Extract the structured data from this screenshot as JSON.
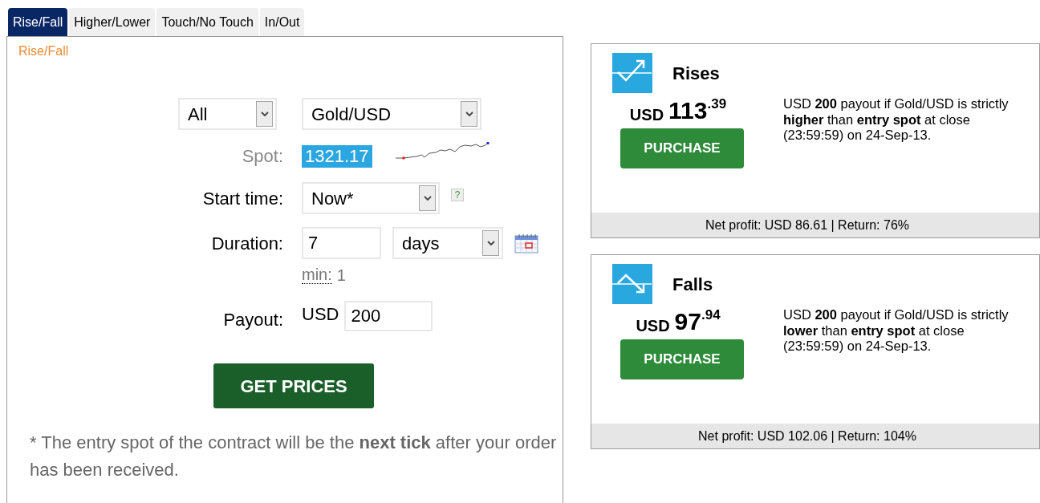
{
  "tabs": [
    {
      "label": "Rise/Fall",
      "selected": true
    },
    {
      "label": "Higher/Lower",
      "selected": false
    },
    {
      "label": "Touch/No Touch",
      "selected": false
    },
    {
      "label": "In/Out",
      "selected": false
    }
  ],
  "panel_title": "Rise/Fall",
  "form": {
    "market_filter": "All",
    "market": "Gold/USD",
    "spot": {
      "label": "Spot:",
      "value": "1321.17"
    },
    "start_time": {
      "label": "Start time:",
      "value": "Now*",
      "help": "?"
    },
    "duration": {
      "label": "Duration:",
      "value": "7",
      "unit": "days",
      "hint_label": "min:",
      "hint_value": "1"
    },
    "payout": {
      "label": "Payout:",
      "currency": "USD",
      "value": "200"
    },
    "button": "GET PRICES",
    "note": "* The entry spot of the contract will be the **next tick** after your order has been received."
  },
  "contracts": [
    {
      "kind": "rise",
      "title": "Rises",
      "currency": "USD",
      "price_whole": "113",
      "price_fraction": ".39",
      "button": "PURCHASE",
      "description": "USD **200** payout if Gold/USD is strictly **higher** than **entry spot** at close (23:59:59) on 24-Sep-13.",
      "footer": "Net profit: USD 86.61 | Return: 76%"
    },
    {
      "kind": "fall",
      "title": "Falls",
      "currency": "USD",
      "price_whole": "97",
      "price_fraction": ".94",
      "button": "PURCHASE",
      "description": "USD **200** payout if Gold/USD is strictly **lower** than **entry spot** at close (23:59:59) on 24-Sep-13.",
      "footer": "Net profit: USD 102.06 | Return: 104%"
    }
  ]
}
